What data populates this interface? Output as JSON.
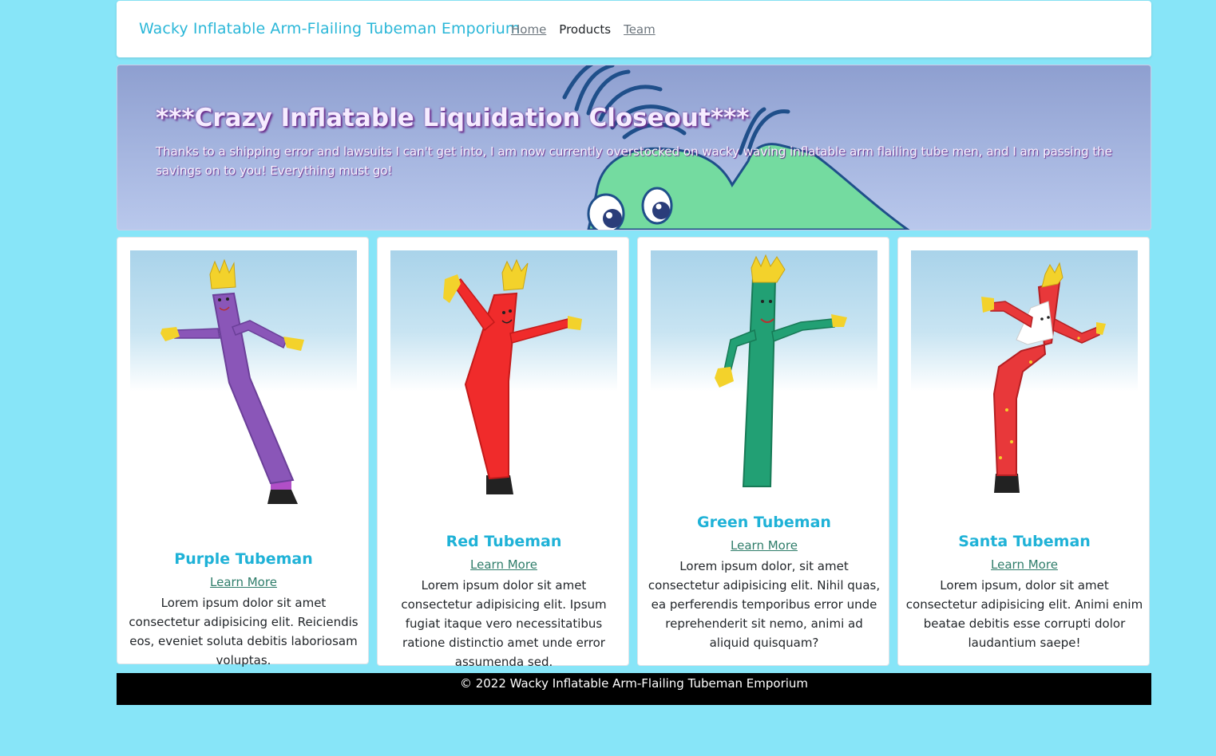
{
  "navbar": {
    "brand": "Wacky Inflatable Arm-Flailing Tubeman Emporium",
    "links": [
      {
        "label": "Home",
        "active": false
      },
      {
        "label": "Products",
        "active": true
      },
      {
        "label": "Team",
        "active": false
      }
    ]
  },
  "hero": {
    "title": "***Crazy Inflatable Liquidation Closeout***",
    "text": "Thanks to a shipping error and lawsuits I can't get into, I am now currently overstocked on wacky waving inflatable arm flailing tube men, and I am passing the savings on to you! Everything must go!"
  },
  "products": [
    {
      "title": "Purple Tubeman",
      "link": "Learn More",
      "text": "Lorem ipsum dolor sit amet consectetur adipisicing elit. Reiciendis eos, eveniet soluta debitis laboriosam voluptas.",
      "color": "#8a56b8"
    },
    {
      "title": "Red Tubeman",
      "link": "Learn More",
      "text": "Lorem ipsum dolor sit amet consectetur adipisicing elit. Ipsum fugiat itaque vero necessitatibus ratione distinctio amet unde error assumenda sed.",
      "color": "#f02b2b"
    },
    {
      "title": "Green Tubeman",
      "link": "Learn More",
      "text": "Lorem ipsum dolor, sit amet consectetur adipisicing elit. Nihil quas, ea perferendis temporibus error unde reprehenderit sit nemo, animi ad aliquid quisquam?",
      "color": "#22a074"
    },
    {
      "title": "Santa Tubeman",
      "link": "Learn More",
      "text": "Lorem ipsum, dolor sit amet consectetur adipisicing elit. Animi enim beatae debitis esse corrupti dolor laudantium saepe!",
      "color": "#e8383a"
    }
  ],
  "footer": {
    "text": "© 2022 Wacky Inflatable Arm-Flailing Tubeman Emporium"
  },
  "colors": {
    "page_background": "#87e5f8",
    "brand": "#2bb7d8",
    "card_title": "#1fb2d7",
    "link": "#2f7d6a"
  }
}
